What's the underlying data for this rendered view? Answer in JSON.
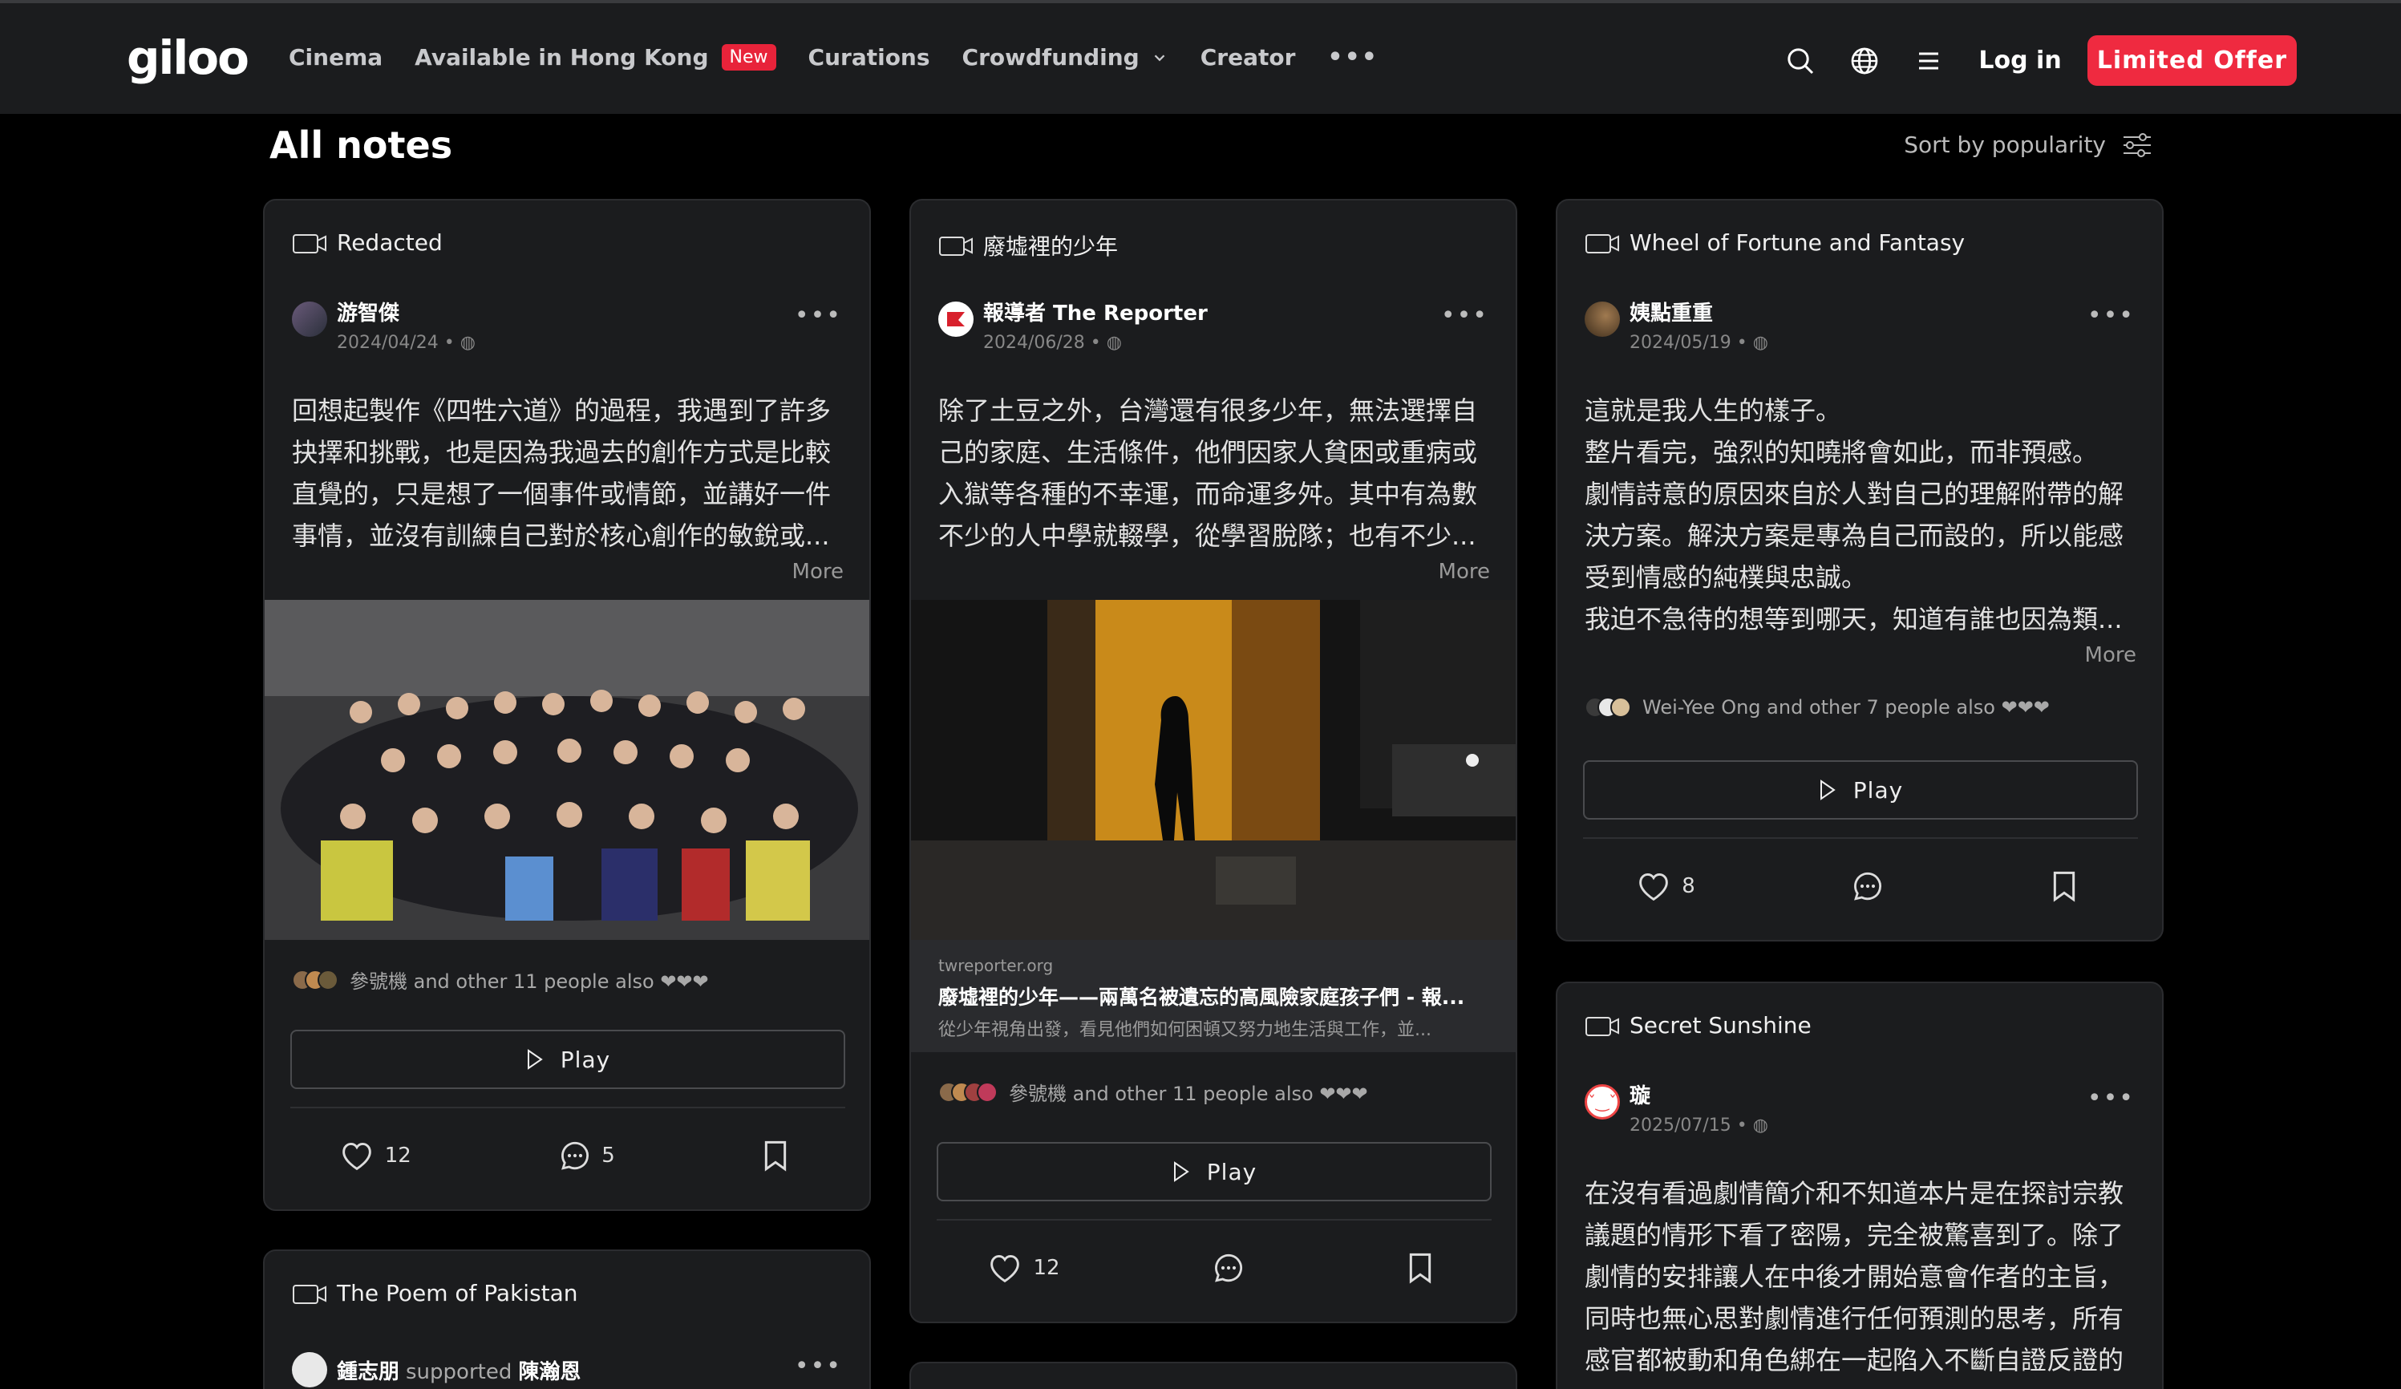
{
  "brand": {
    "logo": "giloo",
    "accent": "#ef2a40"
  },
  "nav": {
    "cinema": "Cinema",
    "available": "Available in Hong Kong",
    "new_badge": "New",
    "curations": "Curations",
    "crowdfunding": "Crowdfunding",
    "creator": "Creator",
    "more": "•••",
    "login": "Log in",
    "offer": "Limited Offer"
  },
  "page": {
    "title": "All notes",
    "sort_label": "Sort by popularity"
  },
  "cards": [
    {
      "film": "Redacted",
      "author": "游智傑",
      "date": "2024/04/24 •",
      "text": "回想起製作《四牲六道》的過程，我遇到了許多\n抉擇和挑戰，也是因為我過去的創作方式是比較\n直覺的，只是想了一個事件或情節，並講好一件\n事情，並沒有訓練自己對於核心創作的敏銳或...",
      "more": "More",
      "also": "參號機 and other 11 people also ❤❤❤",
      "play": "Play",
      "likes": "12",
      "comments": "5"
    },
    {
      "film": "廢墟裡的少年",
      "author": "報導者 The Reporter",
      "date": "2024/06/28 •",
      "text": "除了土豆之外，台灣還有很多少年，無法選擇自\n己的家庭、生活條件，他們因家人貧困或重病或\n入獄等各種的不幸運，而命運多舛。其中有為數\n不少的人中學就輟學，從學習脫隊；也有不少...",
      "more": "More",
      "link_domain": "twreporter.org",
      "link_title": "廢墟裡的少年——兩萬名被遺忘的高風險家庭孩子們 - 報...",
      "link_desc": "從少年視角出發，看見他們如何困頓又努力地生活與工作，並...",
      "also": "參號機 and other 11 people also ❤❤❤",
      "play": "Play",
      "likes": "12"
    },
    {
      "film": "Wheel of Fortune and Fantasy",
      "author": "姨點重重",
      "date": "2024/05/19 •",
      "text": "這就是我人生的樣子。\n整片看完，強烈的知曉將會如此，而非預感。\n劇情詩意的原因來自於人對自己的理解附帶的解\n決方案。解決方案是專為自己而設的，所以能感\n受到情感的純樸與忠誠。\n我迫不急待的想等到哪天，知道有誰也因為類...",
      "more": "More",
      "also": "Wei-Yee Ong and other 7 people also ❤❤❤",
      "play": "Play",
      "likes": "8"
    },
    {
      "film": "Secret Sunshine",
      "author": "璇",
      "date": "2025/07/15 •",
      "text": "在沒有看過劇情簡介和不知道本片是在探討宗教\n議題的情形下看了密陽，完全被驚喜到了。除了\n劇情的安排讓人在中後才開始意會作者的主旨，\n同時也無心思對劇情進行任何預測的思考，所有\n感官都被動和角色綁在一起陷入不斷自證反證的"
    },
    {
      "film": "The Poem of Pakistan",
      "author": "鍾志朋",
      "supported": "supported",
      "supported_name": "陳瀚恩"
    }
  ]
}
